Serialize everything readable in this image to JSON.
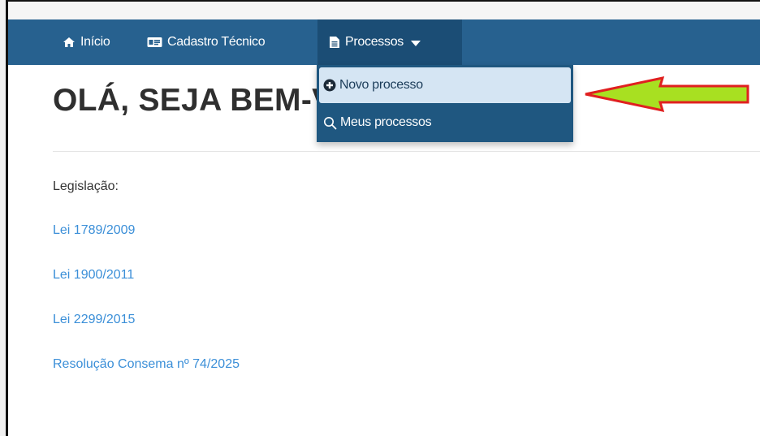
{
  "nav": {
    "inicio_label": "Início",
    "cadastro_label": "Cadastro Técnico",
    "processos_label": "Processos"
  },
  "dropdown": {
    "items": [
      {
        "label": "Novo processo",
        "icon": "plus-circle-icon"
      },
      {
        "label": "Meus processos",
        "icon": "search-icon"
      }
    ]
  },
  "main": {
    "title": "OLÁ, SEJA BEM-VINDO",
    "legislacao_label": "Legislação:",
    "laws": [
      "Lei 1789/2009",
      "Lei 1900/2011",
      "Lei 2299/2015",
      "Resolução Consema nº 74/2025"
    ]
  },
  "colors": {
    "navbar": "#27618f",
    "navbar_active": "#1b4d75",
    "dropdown_bg": "#1f5780",
    "dropdown_highlight": "#d5e5f3",
    "link": "#3b8fd8",
    "arrow_fill": "#a8e021",
    "arrow_stroke": "#e02020"
  }
}
